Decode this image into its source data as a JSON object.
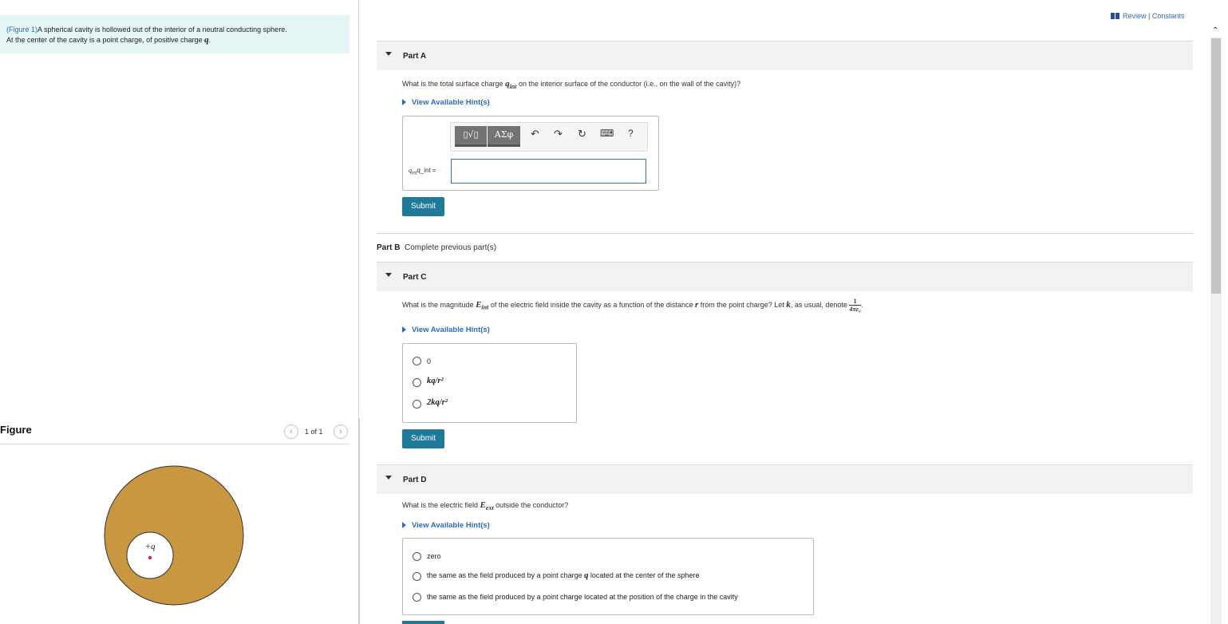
{
  "intro": {
    "figure_link": "(Figure 1)",
    "text_line1": "A spherical cavity is hollowed out of the interior of a neutral conducting sphere.",
    "text_line2": "At the center of the cavity is a point charge, of positive charge ",
    "charge_symbol": "q",
    "period": "."
  },
  "figure_panel": {
    "title": "Figure",
    "counter": "1 of 1",
    "charge_label": "+q",
    "sphere_color": "#c99740",
    "charge_dot_color": "#c8283a"
  },
  "header": {
    "review": "Review",
    "separator": " | ",
    "constants": "Constants"
  },
  "partA": {
    "title": "Part A",
    "question_pre": "What is the total surface charge ",
    "question_sym": "q",
    "question_sub": "int",
    "question_post": " on the interior surface of the conductor (i.e., on the wall of the cavity)?",
    "hint": "View Available Hint(s)",
    "toolbar": {
      "template_btn": "▯√▯",
      "greek_btn": "ΑΣφ",
      "undo": "↶",
      "redo": "↷",
      "reset": "↻",
      "keyboard": "⌨",
      "help": "?"
    },
    "input_label_sym": "q",
    "input_label_sub": "int",
    "input_label_alt": "q_int =",
    "input_value": "",
    "submit": "Submit"
  },
  "partB": {
    "title": "Part B",
    "status": "Complete previous part(s)"
  },
  "partC": {
    "title": "Part C",
    "question_pre": "What is the magnitude ",
    "question_sym": "E",
    "question_sub": "int",
    "question_mid": " of the electric field inside the cavity as a function of the distance ",
    "question_r": "r",
    "question_mid2": " from the point charge? Let ",
    "question_k": "k",
    "question_post": ", as usual, denote ",
    "frac_num": "1",
    "frac_den": "4πε₀",
    "question_end": ".",
    "hint": "View Available Hint(s)",
    "options": [
      "0",
      "kq/r²",
      "2kq/r²"
    ],
    "submit": "Submit"
  },
  "partD": {
    "title": "Part D",
    "question_pre": "What is the electric field ",
    "question_sym": "E",
    "question_sub": "ext",
    "question_post": " outside the conductor?",
    "hint": "View Available Hint(s)",
    "options": [
      "zero",
      "the same as the field produced by a point charge q located at the center of the sphere",
      "the same as the field produced by a point charge located at the position of the charge in the cavity"
    ],
    "option2_pre": "the same as the field produced by a point charge ",
    "option2_sym": "q",
    "option2_post": " located at the center of the sphere"
  },
  "colors": {
    "accent": "#1f7a99",
    "link": "#2a6ebb",
    "intro_bg": "#e5f4f5"
  }
}
